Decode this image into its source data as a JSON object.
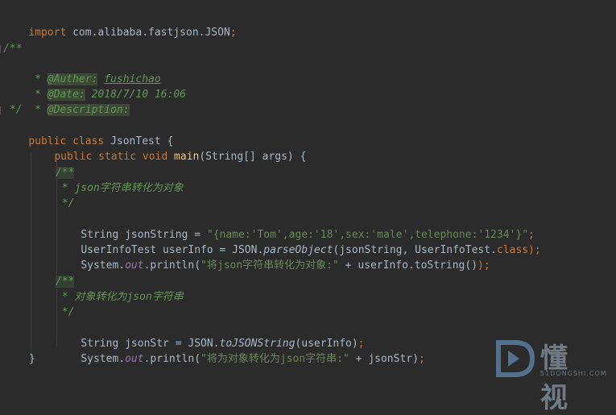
{
  "code": {
    "import_kw": "import",
    "import_path": " com.alibaba.fastjson.JSON",
    "semicolon": ";",
    "doc_open": "/**",
    "doc_star": " * ",
    "doc_close": " */",
    "author_tag": "@Auther:",
    "author_val": "fushichao",
    "date_tag": "@Date:",
    "date_val": " 2018/7/10 16:06",
    "desc_tag": "@Description:",
    "public_kw": "public",
    "class_kw": "class",
    "class_name": " JsonTest {",
    "static_kw": "static",
    "void_kw": "void",
    "main_fn": "main",
    "main_params": "(String[] args) {",
    "cm1_open": "/**",
    "cm1_text": " * json字符串转化为对象",
    "cm1_close": " */",
    "line_jsonString_decl": "String jsonString = ",
    "line_jsonString_val": "\"{name:'Tom',age:'18',sex:'male',telephone:'1234'}\"",
    "line_userinfo_decl": "UserInfoTest userInfo = JSON.",
    "parse_fn": "parseObject",
    "parse_args": "(jsonString, UserInfoTest.",
    "class_literal": "class",
    "close_paren_semi": ");",
    "sys": "System.",
    "out": "out",
    "println": ".println(",
    "print1_str": "\"将json字符串转化为对象:\"",
    "print1_rest": " + userInfo.toString()",
    "cm2_open": "/**",
    "cm2_text": " * 对象转化为json字符串",
    "cm2_close": " */",
    "line_jsonStr_decl": "String jsonStr = JSON.",
    "tojson_fn": "toJSONString",
    "tojson_args": "(userInfo)",
    "print2_str": "\"将为对象转化为json字符串:\"",
    "print2_rest": " + jsonStr)",
    "close_brace": "}"
  },
  "watermark": {
    "text": "懂 视",
    "sub": "51DONGSHI.COM"
  }
}
